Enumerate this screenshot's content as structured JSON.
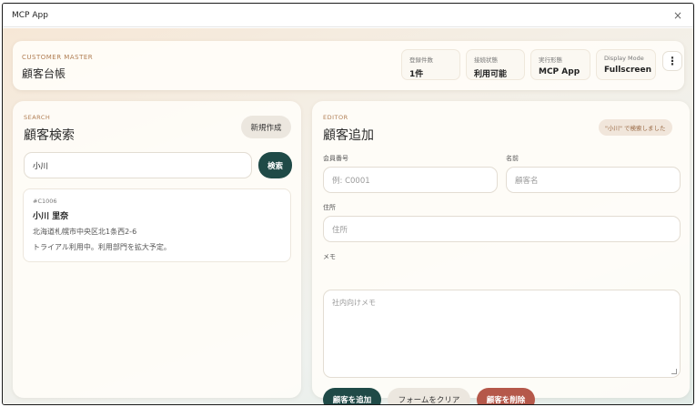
{
  "window": {
    "title": "MCP App",
    "close_glyph": "×"
  },
  "header": {
    "subtitle": "CUSTOMER MASTER",
    "title": "顧客台帳",
    "stats": [
      {
        "label": "登録件数",
        "value": "1件"
      },
      {
        "label": "接続状態",
        "value": "利用可能"
      },
      {
        "label": "実行形態",
        "value": "MCP App"
      },
      {
        "label": "Display Mode",
        "value": "Fullscreen"
      }
    ],
    "menu_glyph": "⋮"
  },
  "search": {
    "subtitle": "SEARCH",
    "title": "顧客検索",
    "new_button": "新規作成",
    "query": "小川",
    "search_button": "検索",
    "results": [
      {
        "id": "#C1006",
        "name": "小川 里奈",
        "address": "北海道札幌市中央区北1条西2-6",
        "memo": "トライアル利用中。利用部門を拡大予定。"
      }
    ]
  },
  "editor": {
    "subtitle": "EDITOR",
    "title": "顧客追加",
    "status_badge": "\"小川\" で検索しました",
    "fields": {
      "member_no": {
        "label": "会員番号",
        "placeholder": "例: C0001"
      },
      "name": {
        "label": "名前",
        "placeholder": "顧客名"
      },
      "address": {
        "label": "住所",
        "placeholder": "住所"
      },
      "memo": {
        "label": "メモ",
        "placeholder": "社内向けメモ"
      }
    },
    "add_button": "顧客を追加",
    "clear_button": "フォームをクリア",
    "delete_button": "顧客を削除"
  },
  "colors": {
    "primary": "#1f4a47",
    "danger": "#b5584a",
    "accent": "#b07d52"
  }
}
